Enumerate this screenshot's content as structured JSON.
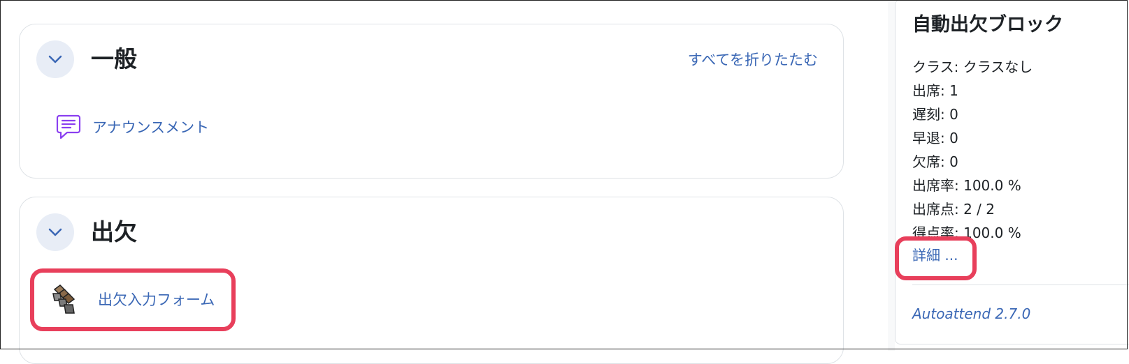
{
  "sections": {
    "general": {
      "title": "一般",
      "collapse_all": "すべてを折りたたむ",
      "activity": {
        "label": "アナウンスメント",
        "icon": "forum-icon"
      }
    },
    "attendance": {
      "title": "出欠",
      "activity": {
        "label": "出欠入力フォーム",
        "icon": "attendance-icon"
      }
    }
  },
  "block": {
    "title": "自動出欠ブロック",
    "stats": [
      "クラス: クラスなし",
      "出席: 1",
      "遅刻: 0",
      "早退: 0",
      "欠席: 0",
      "出席率: 100.0 %",
      "出席点: 2 / 2",
      "得点率: 100.0 %"
    ],
    "details_link": "詳細 ...",
    "version": "Autoattend 2.7.0"
  },
  "colors": {
    "link": "#3a67b5",
    "highlight": "#e83f5b",
    "toggle_bg": "#e8edf6",
    "forum_icon": "#8a3ff0"
  }
}
